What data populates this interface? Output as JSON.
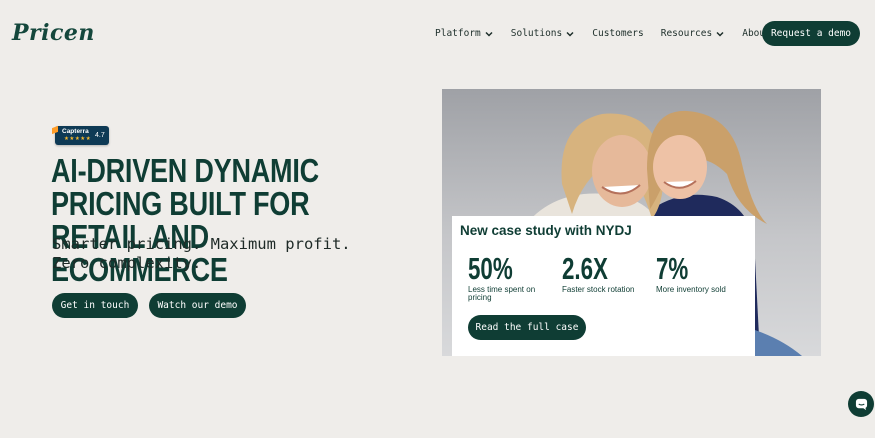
{
  "brand": {
    "logo_text": "Pricen"
  },
  "nav": {
    "items": [
      {
        "label": "Platform",
        "dropdown": true
      },
      {
        "label": "Solutions",
        "dropdown": true
      },
      {
        "label": "Customers",
        "dropdown": false
      },
      {
        "label": "Resources",
        "dropdown": true
      },
      {
        "label": "About",
        "dropdown": false
      }
    ],
    "cta_label": "Request a demo"
  },
  "hero": {
    "badge": {
      "name": "Capterra",
      "rating": "4.7",
      "stars": "★★★★★"
    },
    "headline": "AI-DRIVEN DYNAMIC PRICING BUILT FOR RETAIL AND ECOMMERCE",
    "subheading_line1": "Smarter pricing. Maximum profit.",
    "subheading_line2": "Zero complexity.",
    "primary_button": "Get in touch",
    "secondary_button": "Watch our demo"
  },
  "case_study": {
    "title": "New case study with NYDJ",
    "stats": [
      {
        "value": "50%",
        "label": "Less time spent on pricing"
      },
      {
        "value": "2.6X",
        "label": "Faster stock rotation"
      },
      {
        "value": "7%",
        "label": "More inventory sold"
      }
    ],
    "button_label": "Read the full case"
  },
  "colors": {
    "brand_green": "#0f3d34",
    "background": "#efedea",
    "capterra_navy": "#0e3a55"
  },
  "icons": {
    "chat": "chat-bubble-icon",
    "dropdown": "chevron-down-icon"
  }
}
